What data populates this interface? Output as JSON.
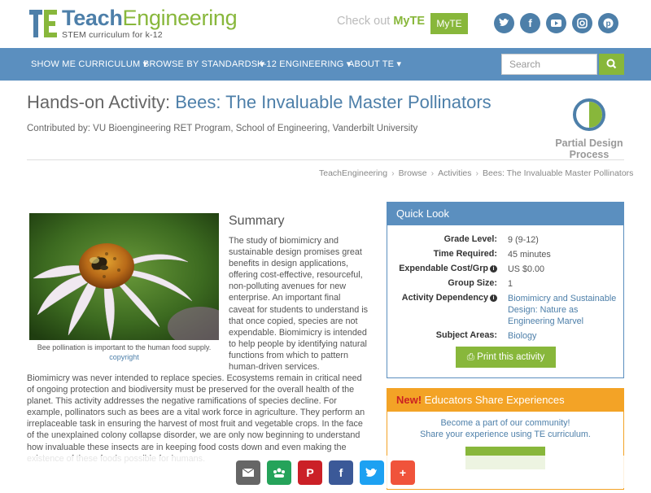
{
  "header": {
    "logo_part1": "Teach",
    "logo_part2": "Engineering",
    "tagline": "STEM curriculum for k-12",
    "checkout_text": "Check out ",
    "checkout_brand": "MyTE",
    "myte_button": "MyTE",
    "social": [
      "twitter-icon",
      "facebook-icon",
      "youtube-icon",
      "instagram-icon",
      "pinterest-icon"
    ]
  },
  "nav": {
    "items": [
      "SHOW ME CURRICULUM",
      "BROWSE BY STANDARDS",
      "K-12 ENGINEERING",
      "ABOUT TE"
    ],
    "search_placeholder": "Search"
  },
  "page": {
    "title_prefix": "Hands-on Activity: ",
    "title_main": "Bees: The Invaluable Master Pollinators",
    "contributed": "Contributed by: VU Bioengineering RET Program, School of Engineering, Vanderbilt University",
    "design_type": "Partial Design Process",
    "breadcrumb": [
      "TeachEngineering",
      "Browse",
      "Activities",
      "Bees: The Invaluable Master Pollinators"
    ]
  },
  "figure": {
    "caption": "Bee pollination is important to the human food supply.",
    "copyright": "copyright"
  },
  "summary": {
    "heading": "Summary",
    "text_side": "The study of biomimicry and sustainable design promises great benefits in design applications, offering cost-effective, resourceful, non-polluting avenues for new enterprise. An important final caveat for students to understand is that once copied, species are not expendable. Biomimicry is intended to help people by identifying natural functions from which to pattern human-driven services.",
    "text_full": "Biomimicry was never intended to replace species. Ecosystems remain in critical need of ongoing protection and biodiversity must be preserved for the overall health of the planet. This activity addresses the negative ramifications of species decline. For example, pollinators such as bees are a vital work force in agriculture. They perform an irreplaceable task in ensuring the harvest of most fruit and vegetable crops. In the face of the unexplained colony collapse disorder, we are only now beginning to understand how invaluable these insects are in keeping food costs down and even making the existence of these foods possible for humans."
  },
  "quick_look": {
    "heading": "Quick Look",
    "rows": [
      {
        "label": "Grade Level:",
        "value": "9 (9-12)"
      },
      {
        "label": "Time Required:",
        "value": "45 minutes"
      },
      {
        "label": "Expendable Cost/Grp",
        "value": "US $0.00"
      },
      {
        "label": "Group Size:",
        "value": "1"
      },
      {
        "label": "Activity Dependency",
        "value": "Biomimicry and Sustainable Design: Nature as Engineering Marvel"
      },
      {
        "label": "Subject Areas:",
        "value": "Biology"
      }
    ],
    "print_button": "Print this activity"
  },
  "educators": {
    "new_label": "New!",
    "heading": " Educators Share Experiences",
    "line1": "Become a part of our community!",
    "line2": "Share your experience using TE curriculum."
  },
  "share_bar": {
    "buttons": [
      {
        "icon": "email-icon",
        "color": "#666666"
      },
      {
        "icon": "google-classroom-icon",
        "color": "#25a35a"
      },
      {
        "icon": "pinterest-icon",
        "color": "#cb2027"
      },
      {
        "icon": "facebook-icon",
        "color": "#3b5998"
      },
      {
        "icon": "twitter-icon",
        "color": "#1da1f2"
      },
      {
        "icon": "more-icon",
        "color": "#f0533b"
      }
    ]
  }
}
